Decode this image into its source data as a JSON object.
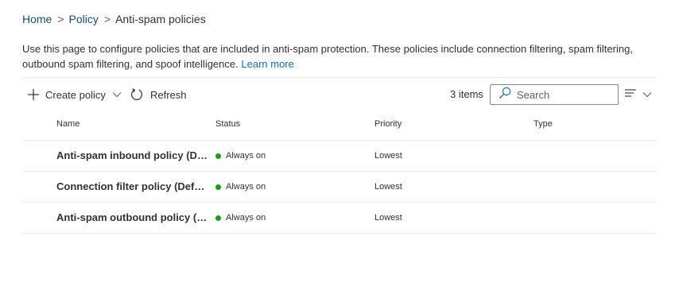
{
  "breadcrumb": {
    "home": "Home",
    "sep1": ">",
    "policy": "Policy",
    "sep2": ">",
    "current": "Anti-spam policies"
  },
  "description": {
    "text": "Use this page to configure policies that are included in anti-spam protection. These policies include connection filtering, spam filtering, outbound spam filtering, and spoof intelligence.",
    "link": "Learn more"
  },
  "toolbar": {
    "create_label": "Create policy",
    "refresh_label": "Refresh",
    "items_count": "3 items",
    "search_placeholder": "Search"
  },
  "icons": {
    "create": "plus-icon",
    "create_menu": "chevron-down-icon",
    "refresh": "refresh-icon",
    "search": "search-icon",
    "filter": "filter-lines-icon"
  },
  "table": {
    "columns": [
      "Name",
      "Status",
      "Priority",
      "Type"
    ],
    "rows": [
      {
        "name": "Anti-spam inbound policy (Default)",
        "status": "Always on",
        "priority": "Lowest",
        "type": ""
      },
      {
        "name": "Connection filter policy (Default)",
        "status": "Always on",
        "priority": "Lowest",
        "type": ""
      },
      {
        "name": "Anti-spam outbound policy (Default)",
        "status": "Always on",
        "priority": "Lowest",
        "type": ""
      }
    ]
  },
  "colors": {
    "link": "#0f6cbd",
    "status_on": "#13a10e",
    "divider": "#edebe9"
  }
}
